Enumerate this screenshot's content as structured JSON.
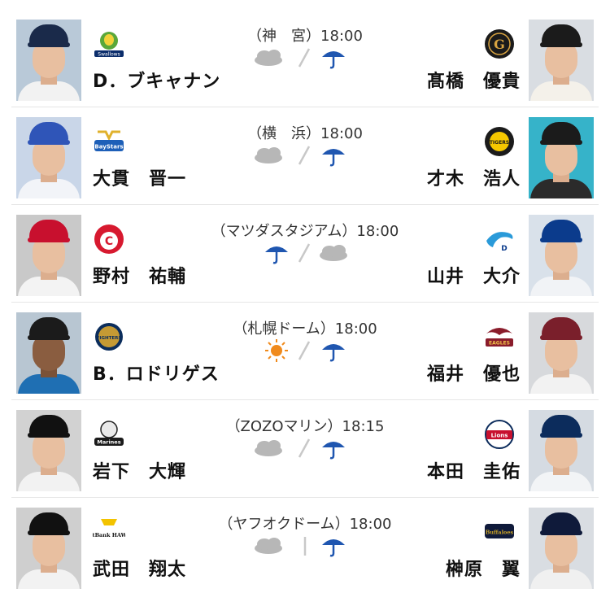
{
  "games": [
    {
      "venue": "（神　宮）18:00",
      "weather": [
        "cloudy",
        "rain"
      ],
      "weather_sep": "slash",
      "home": {
        "pitcher": "D．ブキャナン",
        "logo": "swallows-logo",
        "colors": {
          "cap": "#1a2a4a",
          "body": "#f2f2f2",
          "bg": "#b9c9d8"
        }
      },
      "away": {
        "pitcher": "髙橋　優貴",
        "logo": "giants-logo",
        "colors": {
          "cap": "#1b1b1b",
          "body": "#f4f1ea",
          "bg": "#d9dde2"
        }
      }
    },
    {
      "venue": "（横　浜）18:00",
      "weather": [
        "cloudy",
        "rain"
      ],
      "weather_sep": "slash",
      "home": {
        "pitcher": "大貫　晋一",
        "logo": "baystars-logo",
        "colors": {
          "cap": "#2f55b8",
          "body": "#f2f4f8",
          "bg": "#c9d6e8"
        }
      },
      "away": {
        "pitcher": "才木　浩人",
        "logo": "tigers-logo",
        "colors": {
          "cap": "#1b1b1b",
          "body": "#2b2b2b",
          "bg": "#36b3c9"
        }
      }
    },
    {
      "venue": "（マツダスタジアム）18:00",
      "weather": [
        "rain",
        "cloudy"
      ],
      "weather_sep": "slash",
      "home": {
        "pitcher": "野村　祐輔",
        "logo": "carp-logo",
        "colors": {
          "cap": "#c8102e",
          "body": "#f3f3f3",
          "bg": "#c9c9c9"
        }
      },
      "away": {
        "pitcher": "山井　大介",
        "logo": "dragons-logo",
        "colors": {
          "cap": "#0b3b8c",
          "body": "#f1f3f6",
          "bg": "#d9e1ea"
        }
      }
    },
    {
      "venue": "（札幌ドーム）18:00",
      "weather": [
        "sunny",
        "rain"
      ],
      "weather_sep": "slash",
      "home": {
        "pitcher": "B．ロドリゲス",
        "logo": "fighters-logo",
        "colors": {
          "cap": "#1b1b1b",
          "body": "#1f6fb3",
          "bg": "#b8c6d2"
        }
      },
      "away": {
        "pitcher": "福井　優也",
        "logo": "eagles-logo",
        "colors": {
          "cap": "#7a1f2b",
          "body": "#f2f2f2",
          "bg": "#d7d9dc"
        }
      }
    },
    {
      "venue": "（ZOZOマリン）18:15",
      "weather": [
        "cloudy",
        "rain"
      ],
      "weather_sep": "slash",
      "home": {
        "pitcher": "岩下　大輝",
        "logo": "marines-logo",
        "colors": {
          "cap": "#111111",
          "body": "#f2f2f2",
          "bg": "#d2d2d2"
        }
      },
      "away": {
        "pitcher": "本田　圭佑",
        "logo": "lions-logo",
        "colors": {
          "cap": "#0c2c5c",
          "body": "#f2f4f6",
          "bg": "#d5dbe2"
        }
      }
    },
    {
      "venue": "（ヤフオクドーム）18:00",
      "weather": [
        "cloudy",
        "rain"
      ],
      "weather_sep": "bar",
      "home": {
        "pitcher": "武田　翔太",
        "logo": "hawks-logo",
        "colors": {
          "cap": "#111111",
          "body": "#f2f2f2",
          "bg": "#cfcfcf"
        }
      },
      "away": {
        "pitcher": "榊原　翼",
        "logo": "buffaloes-logo",
        "colors": {
          "cap": "#0f1a3a",
          "body": "#f0f0f0",
          "bg": "#d9dde2"
        }
      }
    }
  ],
  "icon_colors": {
    "cloud": "#b7b7b7",
    "rain": "#1f56b0",
    "sun": "#f08a1c",
    "separator": "#c8c8c8"
  },
  "logo_text": {
    "swallows": "Swallows",
    "giants": "G",
    "baystars": "BayStars",
    "tigers": "TIGERS",
    "carp": "C",
    "dragons": "D",
    "fighters": "FIGHTERS",
    "eagles": "EAGLES",
    "marines": "Marines",
    "lions": "Lions",
    "hawks": "SoftBank HAWKS",
    "buffaloes": "Buffaloes"
  }
}
